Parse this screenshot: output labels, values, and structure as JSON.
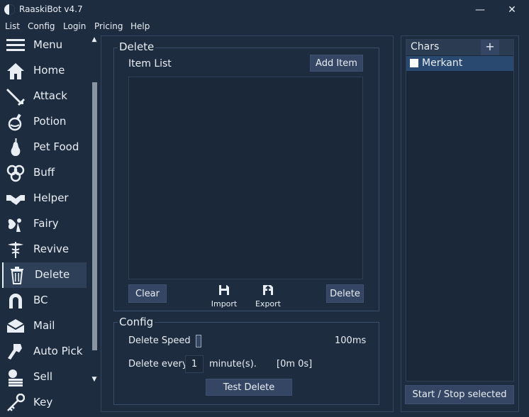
{
  "window": {
    "title": "RaaskiBot v4.7",
    "minimize_glyph": "—",
    "close_glyph": "✕"
  },
  "menubar": [
    "List",
    "Config",
    "Login",
    "Pricing",
    "Help"
  ],
  "sidebar": {
    "items": [
      {
        "label": "Menu",
        "icon": "hamburger-icon"
      },
      {
        "label": "Home",
        "icon": "home-icon"
      },
      {
        "label": "Attack",
        "icon": "sword-icon"
      },
      {
        "label": "Potion",
        "icon": "potion-icon"
      },
      {
        "label": "Pet Food",
        "icon": "pear-icon"
      },
      {
        "label": "Buff",
        "icon": "triskelion-icon"
      },
      {
        "label": "Helper",
        "icon": "handshake-icon"
      },
      {
        "label": "Fairy",
        "icon": "fairy-icon"
      },
      {
        "label": "Revive",
        "icon": "caduceus-icon"
      },
      {
        "label": "Delete",
        "icon": "trash-icon",
        "active": true
      },
      {
        "label": "BC",
        "icon": "horseshoe-icon"
      },
      {
        "label": "Mail",
        "icon": "envelope-icon"
      },
      {
        "label": "Auto Pick",
        "icon": "pickup-hand-icon"
      },
      {
        "label": "Sell",
        "icon": "coins-icon"
      },
      {
        "label": "Key",
        "icon": "key-icon"
      }
    ],
    "scroll_up_glyph": "▲",
    "scroll_down_glyph": "▼"
  },
  "delete_group": {
    "title": "Delete",
    "item_list_label": "Item List",
    "add_item_button": "Add Item",
    "clear_button": "Clear",
    "import_label": "Import",
    "export_label": "Export",
    "delete_button": "Delete"
  },
  "config_group": {
    "title": "Config",
    "delete_speed_label": "Delete Speed",
    "delete_speed_value": "100ms",
    "delete_speed_fraction": 0.0,
    "delete_every_label": "Delete every",
    "delete_every_value": "1",
    "minutes_label": "minute(s).",
    "interval_display": "[0m 0s]",
    "test_delete_button": "Test Delete"
  },
  "chars_panel": {
    "header": "Chars",
    "add_glyph": "+",
    "characters": [
      {
        "name": "Merkant",
        "checked": false,
        "selected": true
      }
    ],
    "start_stop_button": "Start / Stop selected"
  },
  "colors": {
    "background": "#1e2c40",
    "list_background": "#1b2839",
    "button": "#344663",
    "selection": "#2a4971",
    "text": "#e9eef5"
  }
}
